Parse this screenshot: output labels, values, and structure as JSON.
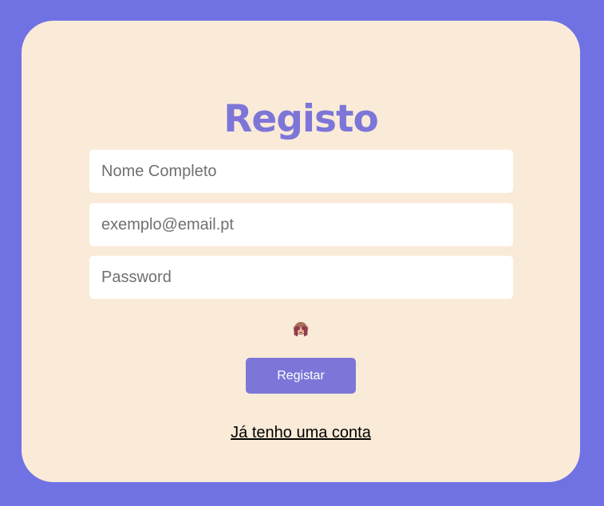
{
  "form": {
    "title": "Registo",
    "fields": {
      "name_placeholder": "Nome Completo",
      "email_placeholder": "exemplo@email.pt",
      "password_placeholder": "Password"
    },
    "password_toggle_icon": "see-no-evil-monkey-icon",
    "submit_label": "Registar",
    "login_link_label": "Já tenho uma conta"
  },
  "colors": {
    "page_background": "#7072e4",
    "card_background": "#faebd8",
    "accent": "#7d76d8",
    "input_background": "#ffffff"
  }
}
